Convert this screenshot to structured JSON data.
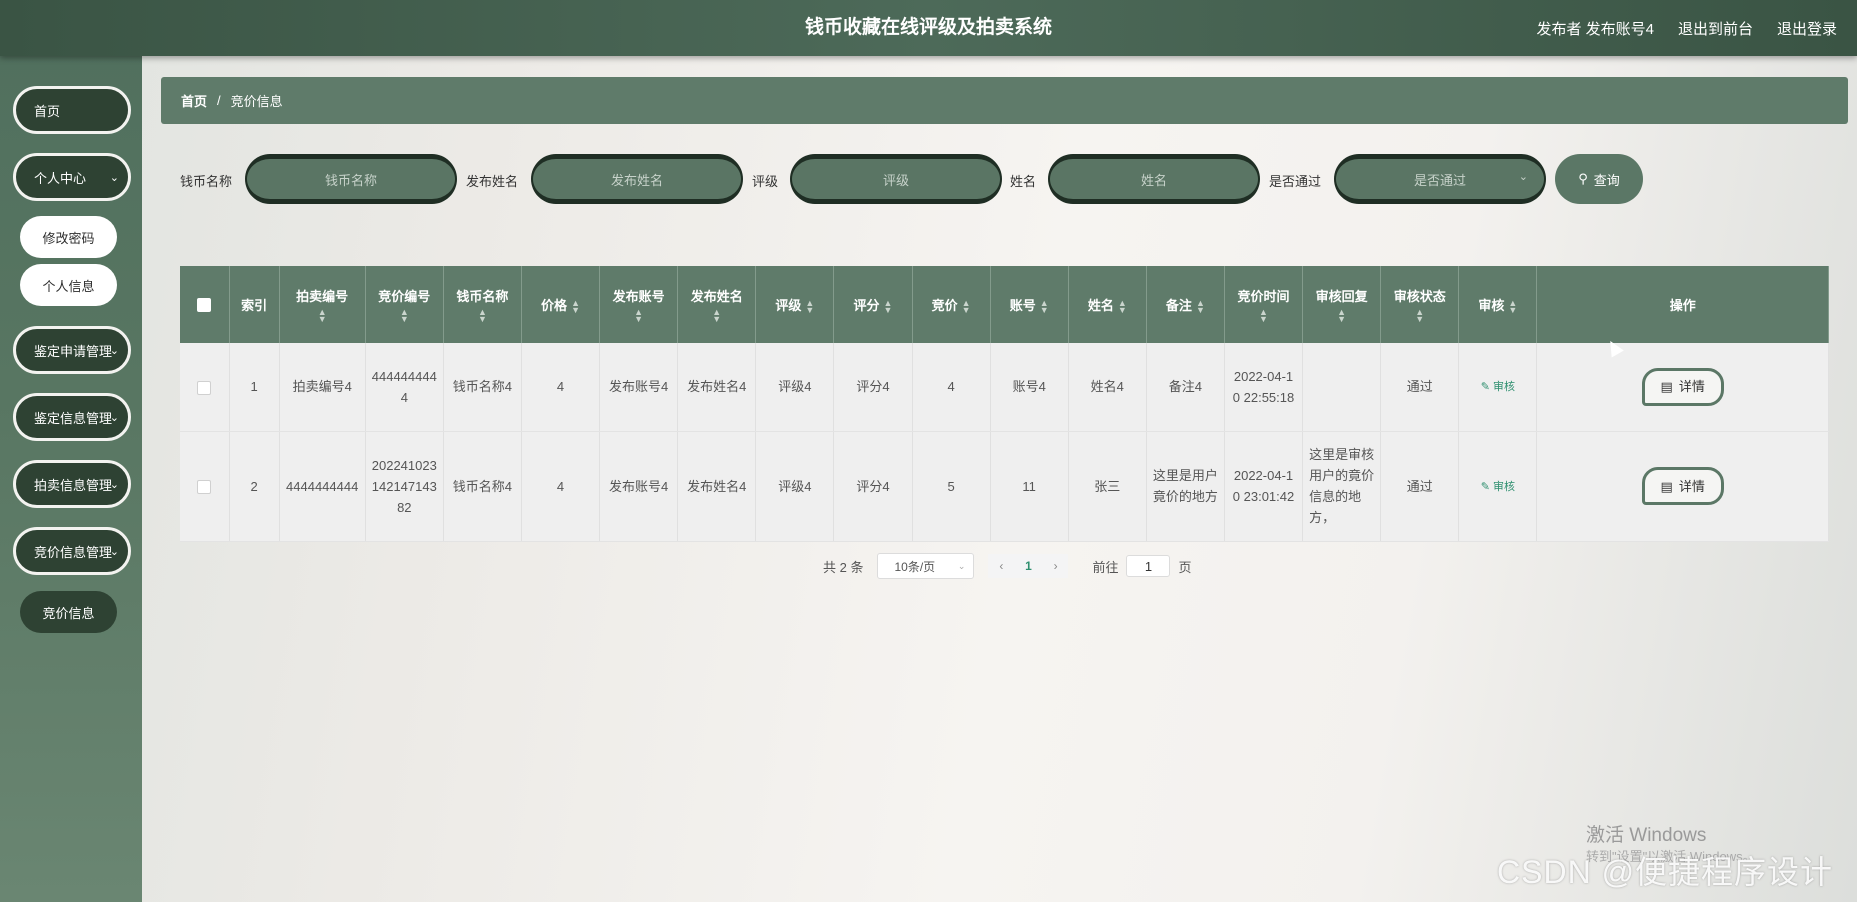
{
  "header": {
    "title": "钱币收藏在线评级及拍卖系统",
    "user": "发布者 发布账号4",
    "back_front": "退出到前台",
    "logout": "退出登录"
  },
  "sidebar": {
    "home": "首页",
    "personal_center": "个人中心",
    "change_password": "修改密码",
    "personal_info": "个人信息",
    "appraisal_apply_mgmt": "鉴定申请管理",
    "appraisal_info_mgmt": "鉴定信息管理",
    "auction_info_mgmt": "拍卖信息管理",
    "bid_info_mgmt": "竞价信息管理",
    "bid_info": "竞价信息"
  },
  "breadcrumb": {
    "home": "首页",
    "sep": "/",
    "current": "竞价信息"
  },
  "search": {
    "coin_name_label": "钱币名称",
    "coin_name_placeholder": "钱币名称",
    "publisher_name_label": "发布姓名",
    "publisher_name_placeholder": "发布姓名",
    "grade_label": "评级",
    "grade_placeholder": "评级",
    "name_label": "姓名",
    "name_placeholder": "姓名",
    "passed_label": "是否通过",
    "passed_placeholder": "是否通过",
    "query_button": "查询"
  },
  "table": {
    "headers": [
      "索引",
      "拍卖编号",
      "竞价编号",
      "钱币名称",
      "价格",
      "发布账号",
      "发布姓名",
      "评级",
      "评分",
      "竞价",
      "账号",
      "姓名",
      "备注",
      "竞价时间",
      "审核回复",
      "审核状态",
      "审核",
      "操作"
    ],
    "rows": [
      {
        "index": "1",
        "auction_no": "拍卖编号4",
        "bid_no": "4444444444",
        "coin_name": "钱币名称4",
        "price": "4",
        "pub_account": "发布账号4",
        "pub_name": "发布姓名4",
        "grade": "评级4",
        "score": "评分4",
        "bid": "4",
        "account": "账号4",
        "name": "姓名4",
        "remark": "备注4",
        "bid_time": "2022-04-10 22:55:18",
        "audit_reply": "",
        "audit_status": "通过",
        "audit_action": "审核",
        "detail": "详情"
      },
      {
        "index": "2",
        "auction_no": "4444444444",
        "bid_no": "20224102314214714382",
        "coin_name": "钱币名称4",
        "price": "4",
        "pub_account": "发布账号4",
        "pub_name": "发布姓名4",
        "grade": "评级4",
        "score": "评分4",
        "bid": "5",
        "account": "11",
        "name": "张三",
        "remark": "这里是用户竟价的地方",
        "bid_time": "2022-04-10 23:01:42",
        "audit_reply": "这里是审核用户的竟价信息的地方，",
        "audit_status": "通过",
        "audit_action": "审核",
        "detail": "详情"
      }
    ]
  },
  "pagination": {
    "total": "共 2 条",
    "page_size": "10条/页",
    "current_page": "1",
    "goto_label": "前往",
    "goto_value": "1",
    "page_unit": "页"
  },
  "watermark": {
    "activate": "激活 Windows",
    "activate_sub": "转到\"设置\"以激活 Windows。",
    "csdn": "CSDN @便捷程序设计"
  }
}
